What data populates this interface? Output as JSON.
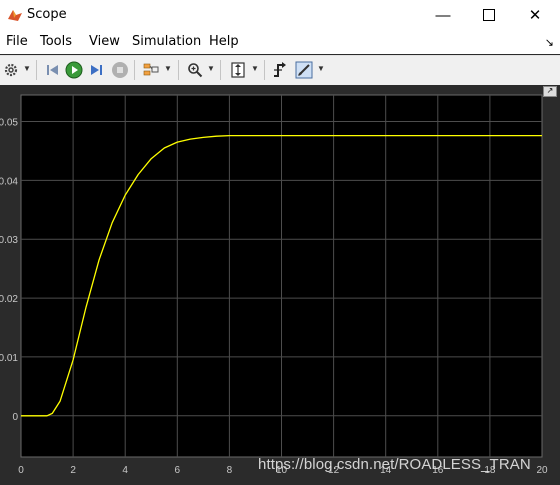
{
  "window": {
    "title": "Scope"
  },
  "menu": {
    "items": [
      "File",
      "Tools",
      "View",
      "Simulation",
      "Help"
    ]
  },
  "toolbar": {
    "icons": [
      "settings-icon",
      "run-icon",
      "step-forward-icon",
      "stop-icon",
      "layout-icon",
      "zoom-icon",
      "autoscale-icon",
      "trigger-icon",
      "highlight-icon"
    ]
  },
  "chart_data": {
    "type": "line",
    "title": "",
    "xlabel": "",
    "ylabel": "",
    "xlim": [
      0,
      20
    ],
    "ylim": [
      -0.007,
      0.0545
    ],
    "xticks": [
      "0",
      "2",
      "4",
      "6",
      "8",
      "10",
      "12",
      "14",
      "16",
      "18",
      "20"
    ],
    "yticks": [
      "0",
      "0.01",
      "0.02",
      "0.03",
      "0.04",
      "0.05"
    ],
    "grid": true,
    "background": "#000000",
    "series": [
      {
        "color": "#ffff00",
        "x": [
          0,
          1,
          1.2,
          1.5,
          2.0,
          2.5,
          3.0,
          3.5,
          4.0,
          4.5,
          5.0,
          5.5,
          6.0,
          6.5,
          7.0,
          7.5,
          8.0,
          9.0,
          10.0,
          12.0,
          14.0,
          16.0,
          18.0,
          20.0
        ],
        "y": [
          0,
          0,
          0.0004,
          0.0025,
          0.0095,
          0.0185,
          0.0265,
          0.0328,
          0.0375,
          0.041,
          0.0437,
          0.0455,
          0.0465,
          0.047,
          0.0473,
          0.0475,
          0.0476,
          0.0476,
          0.0476,
          0.0476,
          0.0476,
          0.0476,
          0.0476,
          0.0476
        ]
      }
    ]
  },
  "watermark": "https://blog.csdn.net/ROADLESS_TRAN"
}
